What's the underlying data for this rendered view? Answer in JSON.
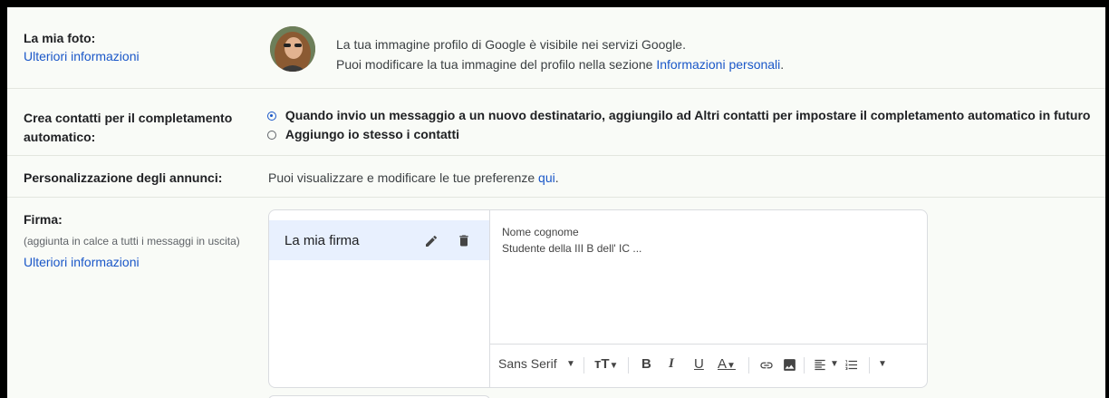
{
  "photo": {
    "title": "La mia foto:",
    "more_link": "Ulteriori informazioni",
    "line1": "La tua immagine profilo di Google è visibile nei servizi Google.",
    "line2_prefix": "Puoi modificare la tua immagine del profilo nella sezione ",
    "line2_link": "Informazioni personali",
    "line2_suffix": "."
  },
  "contacts": {
    "title_line1": "Crea contatti per il completamento",
    "title_line2": "automatico:",
    "option1": "Quando invio un messaggio a un nuovo destinatario, aggiungilo ad Altri contatti per impostare il completamento automatico in futuro",
    "option2": "Aggiungo io stesso i contatti",
    "selected": 1
  },
  "ads": {
    "title": "Personalizzazione degli annunci:",
    "text_prefix": "Puoi visualizzare e modificare le tue preferenze ",
    "link": "qui",
    "text_suffix": "."
  },
  "signature": {
    "title": "Firma:",
    "subtitle": "(aggiunta in calce a tutti i messaggi in uscita)",
    "more_link": "Ulteriori informazioni",
    "list": [
      {
        "name": "La mia firma"
      }
    ],
    "content_line1": "Nome cognome",
    "content_line2": "Studente della III B dell' IC ...",
    "toolbar": {
      "font": "Sans Serif",
      "icons": [
        "font-size-icon",
        "bold-icon",
        "italic-icon",
        "underline-icon",
        "text-color-icon",
        "link-icon",
        "image-icon",
        "align-icon",
        "numbered-list-icon",
        "more-formatting-icon"
      ]
    }
  },
  "colors": {
    "link": "#1a57c8",
    "selected_item_bg": "#e8f0fe",
    "page_bg": "#f9fbf7"
  }
}
